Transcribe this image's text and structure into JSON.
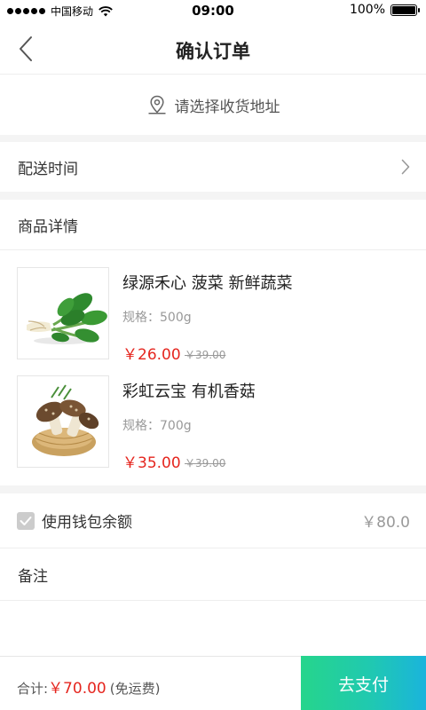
{
  "status_bar": {
    "carrier": "中国移动",
    "time": "09:00",
    "battery": "100%"
  },
  "nav": {
    "title": "确认订单"
  },
  "address": {
    "placeholder": "请选择收货地址"
  },
  "delivery": {
    "label": "配送时间"
  },
  "products": {
    "header": "商品详情",
    "items": [
      {
        "name": "绿源禾心 菠菜 新鲜蔬菜",
        "spec": "规格：500g",
        "price": "￥26.00",
        "original_price": "￥39.00",
        "image_icon": "spinach-image"
      },
      {
        "name": "彩虹云宝 有机香菇",
        "spec": "规格：700g",
        "price": "￥35.00",
        "original_price": "￥39.00",
        "image_icon": "mushroom-image"
      }
    ]
  },
  "wallet": {
    "label": "使用钱包余额",
    "amount": "￥80.0",
    "checked": true
  },
  "remarks": {
    "label": "备注"
  },
  "bottom": {
    "total_label": "合计:",
    "total_amount": "￥70.00",
    "shipping_note": "(免运费)",
    "pay_label": "去支付"
  },
  "colors": {
    "accent_price": "#e5261f",
    "pay_gradient_start": "#26d58c",
    "pay_gradient_end": "#1ab4dc"
  }
}
